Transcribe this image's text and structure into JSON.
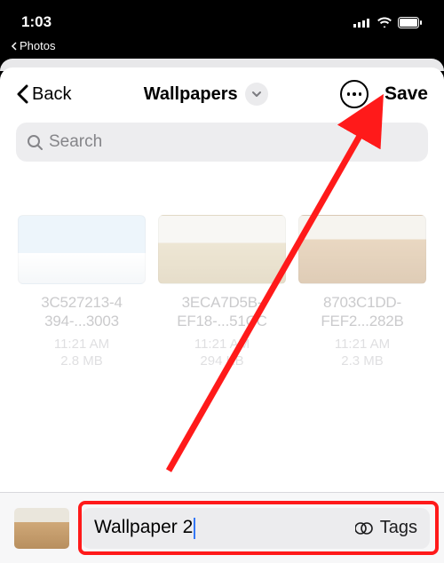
{
  "status": {
    "time": "1:03",
    "back_app": "Photos"
  },
  "nav": {
    "back": "Back",
    "title": "Wallpapers",
    "save": "Save"
  },
  "search": {
    "placeholder": "Search"
  },
  "files": [
    {
      "name_l1": "3C527213-4",
      "name_l2": "394-...3003",
      "time": "11:21 AM",
      "size": "2.8 MB"
    },
    {
      "name_l1": "3ECA7D5B-",
      "name_l2": "EF18-...51CC",
      "time": "11:21 AM",
      "size": "294 KB"
    },
    {
      "name_l1": "8703C1DD-",
      "name_l2": "FEF2...282B",
      "time": "11:21 AM",
      "size": "2.3 MB"
    }
  ],
  "bottom": {
    "filename": "Wallpaper 2",
    "tags": "Tags"
  }
}
